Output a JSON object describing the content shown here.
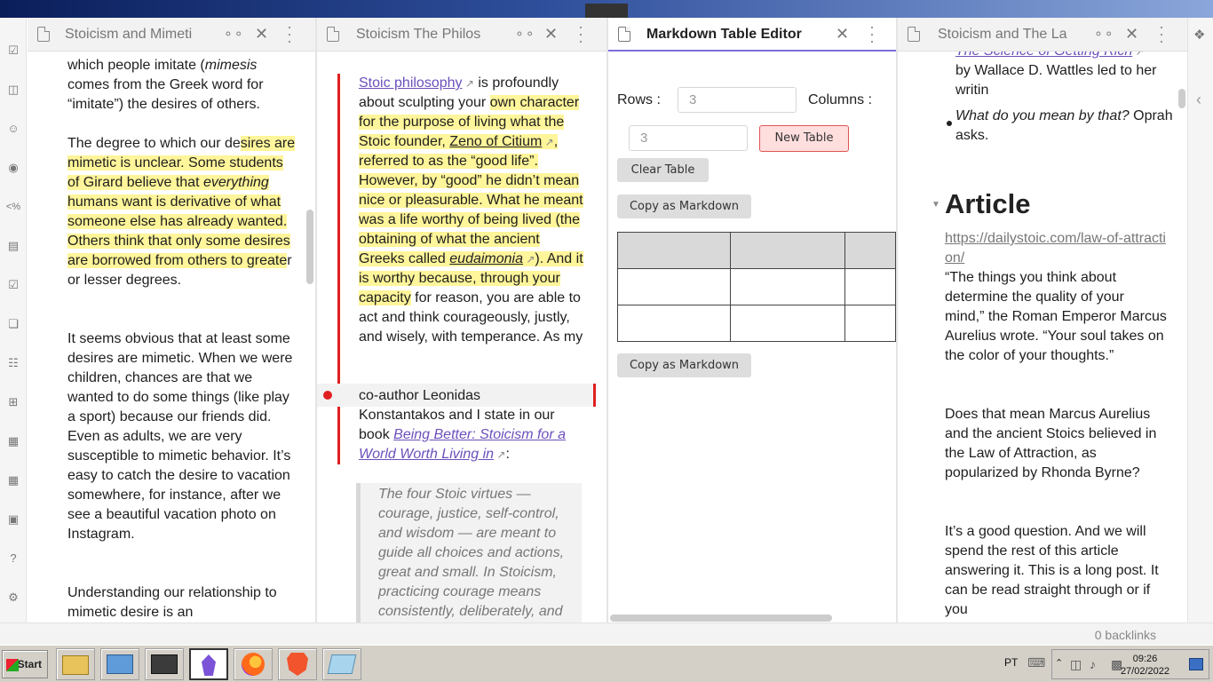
{
  "panes": {
    "p1": {
      "title": "Stoicism and Mimeti"
    },
    "p2": {
      "title": "Stoicism  The Philos"
    },
    "p3": {
      "title": "Markdown Table Editor"
    },
    "p4": {
      "title": "Stoicism and The La"
    }
  },
  "pane1": {
    "p1_frag": "which people imitate (",
    "p1_it": "mimesis",
    "p1_l2": "comes from the Greek word for",
    "p1_l3": "“imitate”) the desires of others.",
    "p2a": "The degree to which our de",
    "p2b": "sires are mimetic is unclear. Some students of Girard believe that ",
    "p2c": "everything",
    "p2d": " humans want is derivative of what someone else has already wanted. Others think that only some desires are borrowed from others to greate",
    "p2e": "r or lesser degrees.",
    "p3": "It seems obvious that at least some desires are mimetic. When we were children, chances are that we wanted to do some things (like play a sport) because our friends did. Even as adults, we are very susceptible to mimetic behavior. It’s easy to catch the desire to vacation somewhere, for instance, after we see a beautiful vacation photo on Instagram.",
    "p4": "Understanding our relationship to mimetic desire is an"
  },
  "pane2": {
    "link1": "Stoic philosophy",
    "t1": " is profoundly about sculpting your ",
    "h1": "own character for the purpose of living what the Stoic founder, ",
    "link2": "Zeno of Citium",
    "h2": ", referred to as the “good life”. However, by “good” he didn’t mean nice or pleasurable. What he meant was a life worthy of being lived (the obtaining of what the ancient Greeks called ",
    "link3": "eudaimonia",
    "h3": "). And it is worthy because, through your capacity",
    "t2": " for reason, you are able to act and think courageously, justly, and wisely, with temperance. As my",
    "t3": "co-author Leonidas",
    "t4": "Konstantakos and I state in our book ",
    "link4": "Being Better: Stoicism for a World Worth Living in",
    "t5": ":",
    "quote": "The four Stoic virtues — courage, justice, self-control, and wisdom — are meant to guide all choices and actions, great and small. In Stoicism, practicing courage means consistently, deliberately, and"
  },
  "editor": {
    "rows_label": "Rows :",
    "cols_label": "Columns :",
    "rows_value": "3",
    "cols_value": "3",
    "new_table": "New Table",
    "clear_table": "Clear Table",
    "copy_md": "Copy as Markdown",
    "copy_md2": "Copy as Markdown"
  },
  "pane4": {
    "link_top": "The Science of Getting Rich",
    "l1": "by Wallace D. Wattles led to her writin",
    "bullet": "What do you mean by that?",
    "bullet2": " Oprah asks.",
    "heading": "Article",
    "url": "https://dailystoic.com/law-of-attraction/",
    "p1": "“The things you think about determine the quality of your mind,” the Roman Emperor Marcus Aurelius wrote. “Your soul takes on the color of your thoughts.”",
    "p2": "Does that mean Marcus Aurelius and the ancient Stoics believed in the Law of Attraction, as popularized by Rhonda Byrne?",
    "p3": "It’s a good question. And we will spend the rest of this article answering it. This is a long post. It can be read straight through or if you"
  },
  "status": {
    "backlinks": "0 backlinks"
  },
  "taskbar": {
    "start": "Start",
    "lang": "PT",
    "time": "09:26",
    "date": "27/02/2022"
  },
  "icons": [
    "file-check-icon",
    "tv-icon",
    "smile-icon",
    "record-icon",
    "percent-icon",
    "file-list-icon",
    "calendar-check-icon",
    "copy-icon",
    "cards-icon",
    "grid-plus-icon",
    "table-icon",
    "table-plus-icon",
    "camera-icon",
    "help-icon",
    "settings-icon"
  ]
}
